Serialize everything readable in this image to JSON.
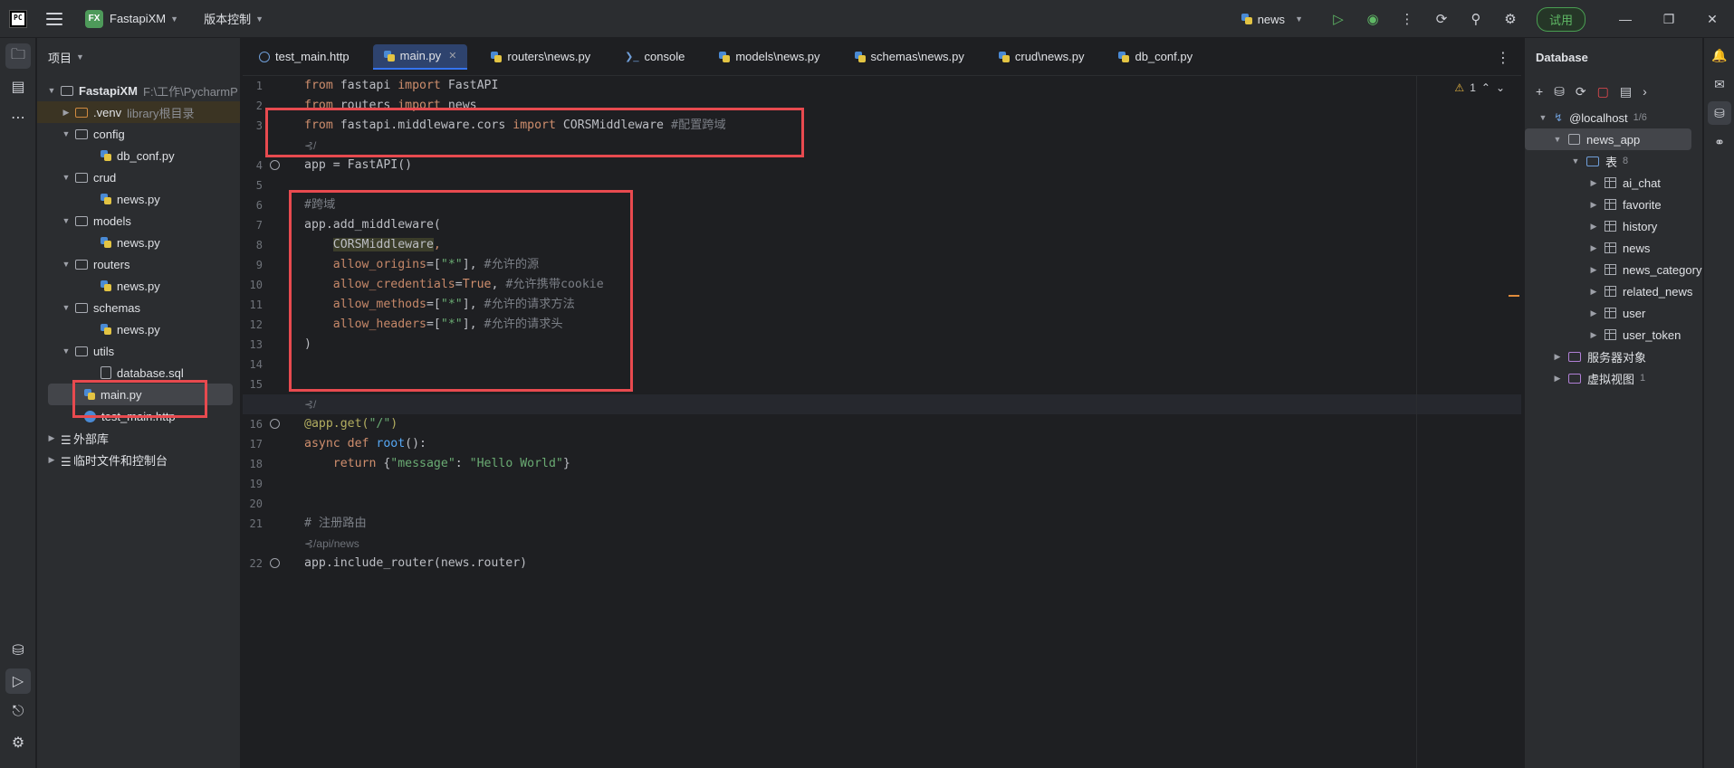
{
  "titlebar": {
    "logo_text": "PC",
    "project_badge": "FX",
    "project_name": "FastapiXM",
    "vcs_label": "版本控制",
    "run_config": "news",
    "trial_label": "试用"
  },
  "project_panel": {
    "title": "项目",
    "root": "FastapiXM",
    "root_path": "F:\\工作\\PycharmP",
    "items": [
      {
        "name": ".venv",
        "note": "library根目录"
      },
      {
        "name": "config"
      },
      {
        "name": "db_conf.py"
      },
      {
        "name": "crud"
      },
      {
        "name": "news.py"
      },
      {
        "name": "models"
      },
      {
        "name": "news.py"
      },
      {
        "name": "routers"
      },
      {
        "name": "news.py"
      },
      {
        "name": "schemas"
      },
      {
        "name": "news.py"
      },
      {
        "name": "utils"
      },
      {
        "name": "database.sql"
      },
      {
        "name": "main.py"
      },
      {
        "name": "test_main.http"
      },
      {
        "name": "外部库"
      },
      {
        "name": "临时文件和控制台"
      }
    ]
  },
  "tabs": [
    {
      "label": "test_main.http"
    },
    {
      "label": "main.py"
    },
    {
      "label": "routers\\news.py"
    },
    {
      "label": "console"
    },
    {
      "label": "models\\news.py"
    },
    {
      "label": "schemas\\news.py"
    },
    {
      "label": "crud\\news.py"
    },
    {
      "label": "db_conf.py"
    }
  ],
  "editor": {
    "warning_count": "1",
    "line_numbers": [
      "1",
      "2",
      "3",
      "",
      "4",
      "5",
      "6",
      "7",
      "8",
      "9",
      "10",
      "11",
      "12",
      "13",
      "14",
      "15",
      "",
      "16",
      "17",
      "18",
      "19",
      "20",
      "21",
      "",
      "22"
    ],
    "code": {
      "l1_kw": "from",
      "l1_mod": " fastapi ",
      "l1_kw2": "import",
      "l1_name": " FastAPI",
      "l2_kw": "from",
      "l2_mod": " routers ",
      "l2_kw2": "import",
      "l2_name": " news",
      "l3_kw": "from",
      "l3_mod": " fastapi.middleware.cors ",
      "l3_kw2": "import",
      "l3_name": " CORSMiddleware ",
      "l3_cmt": "#配置跨域",
      "hint_usages": "⊰/",
      "l4": "app = FastAPI()",
      "l6_cmt": "#跨域",
      "l7": "app.add_middleware(",
      "l8_word": "CORSMiddleware",
      "l8_rest": ",",
      "l9_param": "allow_origins",
      "l9_eq": "=[",
      "l9_str": "\"*\"",
      "l9_end": "], ",
      "l9_cmt": "#允许的源",
      "l10_param": "allow_credentials",
      "l10_eq": "=",
      "l10_kw": "True",
      "l10_end": ", ",
      "l10_cmt": "#允许携带cookie",
      "l11_param": "allow_methods",
      "l11_eq": "=[",
      "l11_str": "\"*\"",
      "l11_end": "], ",
      "l11_cmt": "#允许的请求方法",
      "l12_param": "allow_headers",
      "l12_eq": "=[",
      "l12_str": "\"*\"",
      "l12_end": "], ",
      "l12_cmt": "#允许的请求头",
      "l13": ")",
      "l16_deco": "@app.get(",
      "l16_str": "\"/\"",
      "l16_end": ")",
      "l17_kw": "async def ",
      "l17_fn": "root",
      "l17_end": "():",
      "l18_kw": "return ",
      "l18_b1": "{",
      "l18_s1": "\"message\"",
      "l18_c": ": ",
      "l18_s2": "\"Hello World\"",
      "l18_b2": "}",
      "l21_cmt": "# 注册路由",
      "hint_route": "⊰/api/news",
      "l22": "app.include_router(news.router)"
    }
  },
  "database": {
    "title": "Database",
    "connection": "@localhost",
    "connection_count": "1/6",
    "schema": "news_app",
    "tables_label": "表",
    "tables_count": "8",
    "tables": [
      "ai_chat",
      "favorite",
      "history",
      "news",
      "news_category",
      "related_news",
      "user",
      "user_token"
    ],
    "server_objects": "服务器对象",
    "virtual_views": "虚拟视图",
    "virtual_views_count": "1"
  }
}
